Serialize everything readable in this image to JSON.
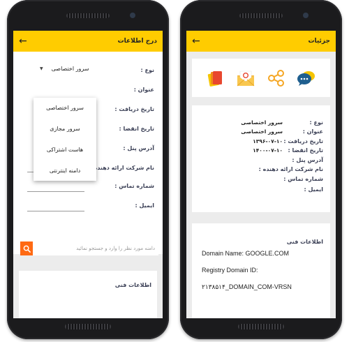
{
  "left": {
    "title": "درج اطلاعات",
    "select_value": "سرور اختصاصی",
    "labels": {
      "type": "نوع :",
      "title": "عنوان :",
      "received": "تاریخ دریافت :",
      "expire": "تاریخ انقضا :",
      "panel": "آدرس پنل :",
      "provider": "نام شرکت ارائه دهنده :",
      "phone": "شماره تماس :",
      "email": "ایمیل :"
    },
    "dropdown": [
      "سرور اختصاصی",
      "سرور مجازی",
      "هاست اشتراکی",
      "دامنه اینترنتی"
    ],
    "search_placeholder": "دامنه مورد نظر را وارد و جستجو نمائید",
    "tech_heading": "اطلاعات فنی"
  },
  "right": {
    "title": "جزئیات",
    "icons": [
      "files-icon",
      "mail-icon",
      "share-icon",
      "chat-icon"
    ],
    "labels": {
      "type": "نوع :",
      "title": "عنوان :",
      "received": "تاریخ دریافت :",
      "expire": "تاریخ انقضا :",
      "panel": "آدرس پنل :",
      "provider": "نام شرکت ارائه دهنده :",
      "phone": "شماره تماس :",
      "email": "ایمیل :"
    },
    "values": {
      "type": "سرور اختصاصی",
      "title": "سرور اختصاصی",
      "received": "۱۳۹۶-۰۷-۱۰",
      "expire": "۱۴۰۰-۰۷-۱۰"
    },
    "tech_heading": "اطلاعات فنی",
    "tech_lines": [
      "Domain Name: GOOGLE.COM",
      "Registry Domain ID:",
      "۲۱۳۸۵۱۴_DOMAIN_COM-VRSN"
    ]
  },
  "colors": {
    "appbar": "#ffcc00",
    "search_button": "#ff6a13"
  }
}
